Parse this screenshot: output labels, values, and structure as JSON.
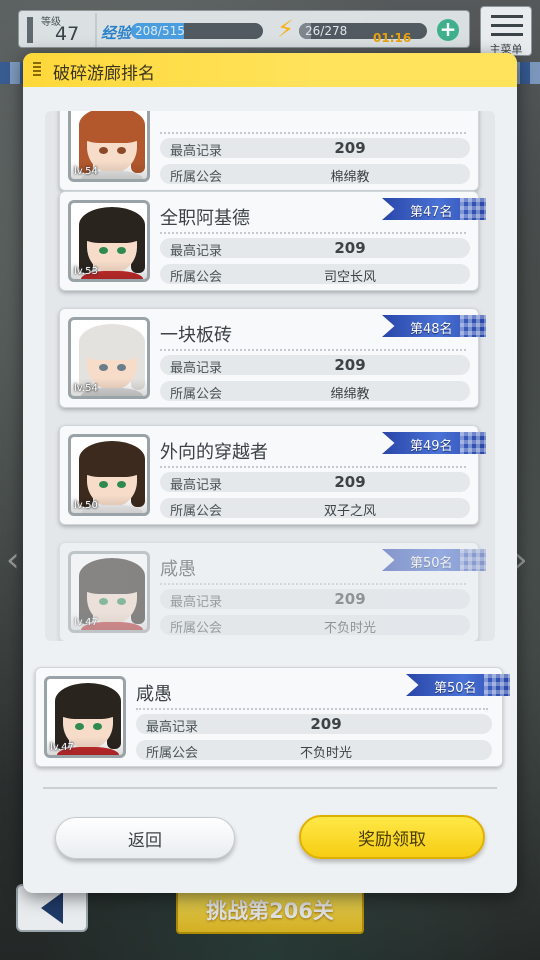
{
  "hud": {
    "level_label": "等级",
    "level": "47",
    "exp_label": "经验",
    "exp_text": "208/515",
    "exp_fraction": 0.404,
    "stamina_text": "26/278",
    "stamina_fraction": 0.094,
    "stamina_timer": "01:16",
    "menu_label": "主菜单"
  },
  "modal": {
    "title": "破碎游廊排名",
    "record_label": "最高记录",
    "guild_label": "所属公会",
    "back_label": "返回",
    "reward_label": "奖励领取"
  },
  "rankings": [
    {
      "name": "",
      "rank": "",
      "record": "209",
      "guild": "棉绵教",
      "level": "lv.54",
      "hair": "#b3582d",
      "shirt": "#e8e8e8",
      "eyes": "#8a4a2a",
      "faded": false
    },
    {
      "name": "全职阿基德",
      "rank": "第47名",
      "record": "209",
      "guild": "司空长风",
      "level": "lv.53",
      "hair": "#2a241f",
      "shirt": "#c42b2b",
      "eyes": "#2f8a4f",
      "faded": false
    },
    {
      "name": "一块板砖",
      "rank": "第48名",
      "record": "209",
      "guild": "绵绵教",
      "level": "lv.54",
      "hair": "#e4e2de",
      "shirt": "#d8d8d8",
      "eyes": "#6a7d8a",
      "faded": false
    },
    {
      "name": "外向的穿越者",
      "rank": "第49名",
      "record": "209",
      "guild": "双子之风",
      "level": "lv.50",
      "hair": "#3c2a1e",
      "shirt": "#f2f2f2",
      "eyes": "#2f8a4f",
      "faded": false
    },
    {
      "name": "咸愚",
      "rank": "第50名",
      "record": "209",
      "guild": "不负时光",
      "level": "lv.47",
      "hair": "#2a241f",
      "shirt": "#c42b2b",
      "eyes": "#2f8a4f",
      "faded": true
    }
  ],
  "my_rank": {
    "name": "咸愚",
    "rank": "第50名",
    "record": "209",
    "guild": "不负时光",
    "level": "lv.47",
    "hair": "#2a241f",
    "shirt": "#c42b2b",
    "eyes": "#2f8a4f"
  },
  "bottom": {
    "challenge_label": "挑战第206关"
  },
  "colors": {
    "accent_yellow": "#ffd83a",
    "rank_blue": "#2946a8",
    "exp_blue": "#4a9ee0"
  }
}
